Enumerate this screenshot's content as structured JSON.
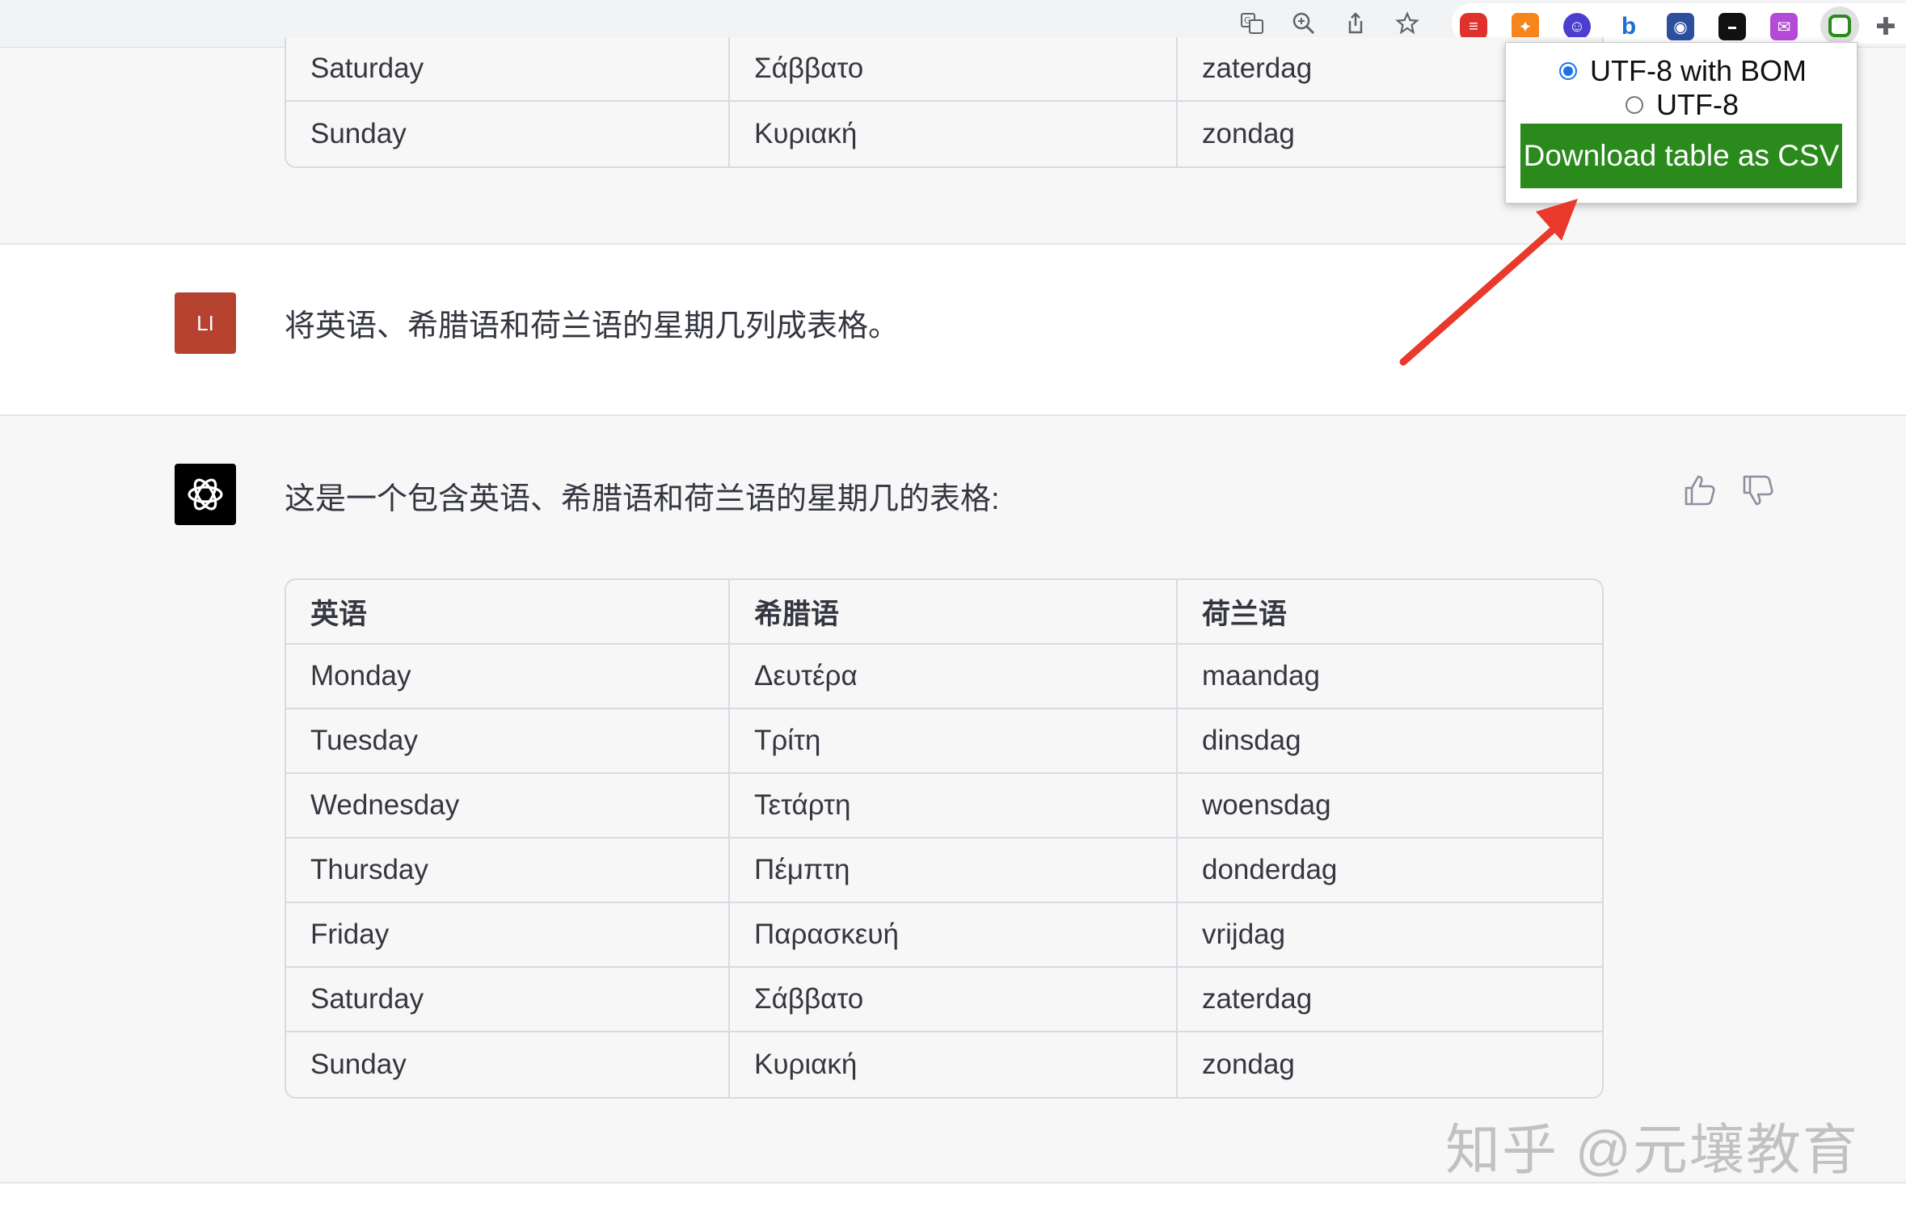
{
  "toolbar": {
    "icons": [
      "translate-icon",
      "zoom-icon",
      "share-icon",
      "bookmark-star-icon"
    ],
    "extensions": [
      "extension-red",
      "extension-fox",
      "extension-purple-face",
      "extension-bing",
      "extension-globe",
      "extension-prompts",
      "extension-chat",
      "extension-csv",
      "puzzle-icon"
    ]
  },
  "top_table": {
    "rows": [
      [
        "Saturday",
        "Σάββατο",
        "zaterdag"
      ],
      [
        "Sunday",
        "Κυριακή",
        "zondag"
      ]
    ]
  },
  "user_message": {
    "avatar_initials": "LI",
    "text": "将英语、希腊语和荷兰语的星期几列成表格。"
  },
  "assistant_message": {
    "intro": "这是一个包含英语、希腊语和荷兰语的星期几的表格:",
    "table": {
      "headers": [
        "英语",
        "希腊语",
        "荷兰语"
      ],
      "rows": [
        [
          "Monday",
          "Δευτέρα",
          "maandag"
        ],
        [
          "Tuesday",
          "Τρίτη",
          "dinsdag"
        ],
        [
          "Wednesday",
          "Τετάρτη",
          "woensdag"
        ],
        [
          "Thursday",
          "Πέμπτη",
          "donderdag"
        ],
        [
          "Friday",
          "Παρασκευή",
          "vrijdag"
        ],
        [
          "Saturday",
          "Σάββατο",
          "zaterdag"
        ],
        [
          "Sunday",
          "Κυριακή",
          "zondag"
        ]
      ]
    }
  },
  "popup": {
    "options": [
      "UTF-8 with BOM",
      "UTF-8"
    ],
    "selected": "UTF-8 with BOM",
    "button_label": "Download table as CSV",
    "button_color": "#2a8a1c"
  },
  "watermark": "知乎 @元壤教育",
  "colors": {
    "user_avatar": "#b5412f",
    "assistant_avatar": "#000000",
    "arrow": "#e8392a"
  }
}
